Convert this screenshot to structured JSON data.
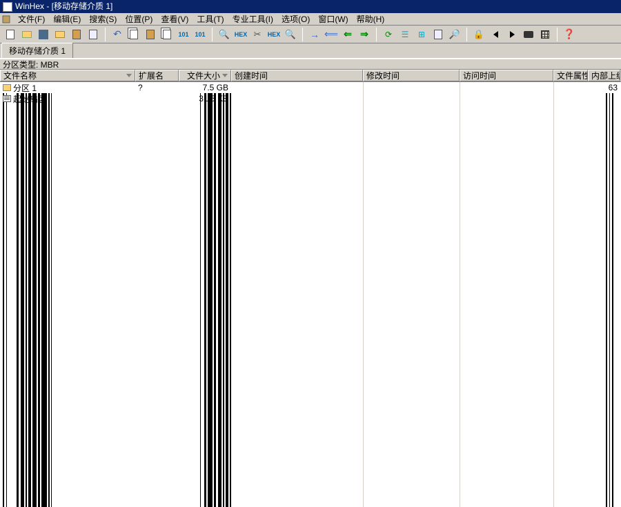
{
  "title": "WinHex - [移动存储介质 1]",
  "menu": [
    "文件(F)",
    "编辑(E)",
    "搜索(S)",
    "位置(P)",
    "查看(V)",
    "工具(T)",
    "专业工具(I)",
    "选项(O)",
    "窗口(W)",
    "帮助(H)"
  ],
  "tab": "移动存储介质 1",
  "info": "分区类型: MBR",
  "columns": {
    "name": "文件名称",
    "ext": "扩展名",
    "size": "文件大小",
    "created": "创建时间",
    "modified": "修改时间",
    "accessed": "访问时间",
    "attr": "文件属性",
    "sector": "内部上级目录"
  },
  "rows": [
    {
      "name": "分区 1",
      "ext": "?",
      "size": "7.5 GB",
      "sector": "63"
    },
    {
      "name": "起始扇区",
      "ext": "",
      "size": "31.5 KB",
      "sector": ""
    }
  ]
}
